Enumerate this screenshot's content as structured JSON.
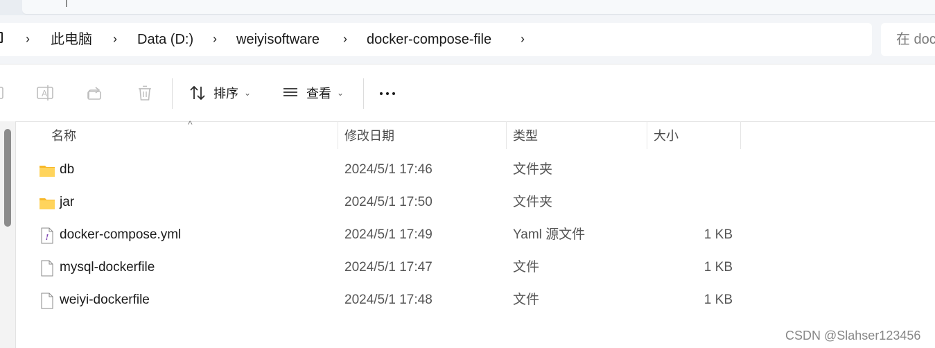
{
  "breadcrumb": {
    "segments": [
      "此电脑",
      "Data (D:)",
      "weiyisoftware",
      "docker-compose-file"
    ]
  },
  "search": {
    "placeholder": "在 doc"
  },
  "toolbar": {
    "sort_label": "排序",
    "view_label": "查看",
    "icons": [
      "ai-text-icon",
      "share-icon",
      "delete-icon",
      "sort-arrows-icon",
      "view-lines-icon",
      "more-icon"
    ]
  },
  "columns": {
    "name": "名称",
    "modified": "修改日期",
    "type": "类型",
    "size": "大小"
  },
  "files": [
    {
      "name": "db",
      "modified": "2024/5/1 17:46",
      "type": "文件夹",
      "size": "",
      "icon": "folder-icon"
    },
    {
      "name": "jar",
      "modified": "2024/5/1 17:50",
      "type": "文件夹",
      "size": "",
      "icon": "folder-icon"
    },
    {
      "name": "docker-compose.yml",
      "modified": "2024/5/1 17:49",
      "type": "Yaml 源文件",
      "size": "1 KB",
      "icon": "yaml-file-icon"
    },
    {
      "name": "mysql-dockerfile",
      "modified": "2024/5/1 17:47",
      "type": "文件",
      "size": "1 KB",
      "icon": "file-icon"
    },
    {
      "name": "weiyi-dockerfile",
      "modified": "2024/5/1 17:48",
      "type": "文件",
      "size": "1 KB",
      "icon": "file-icon"
    }
  ],
  "watermark": "CSDN @Slahser123456",
  "colors": {
    "folder": "#ffca3a",
    "background": "#ffffff",
    "toolbar_bg": "#f3f5f8"
  }
}
